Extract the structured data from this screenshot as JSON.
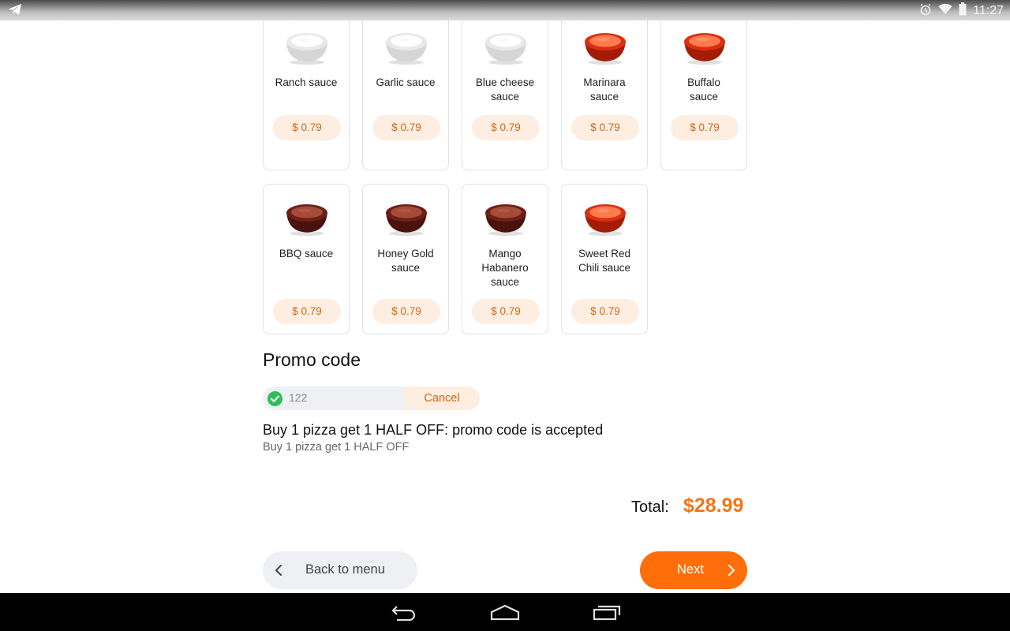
{
  "status_bar": {
    "time": "11:27",
    "icons": [
      "telegram-icon",
      "alarm-icon",
      "wifi-icon",
      "battery-icon"
    ]
  },
  "sauces": [
    {
      "name": "Ranch sauce",
      "price": "$ 0.79",
      "color": "white"
    },
    {
      "name": "Garlic sauce",
      "price": "$ 0.79",
      "color": "white"
    },
    {
      "name": "Blue cheese sauce",
      "price": "$ 0.79",
      "color": "white"
    },
    {
      "name": "Marinara sauce",
      "price": "$ 0.79",
      "color": "red"
    },
    {
      "name": "Buffalo sauce",
      "price": "$ 0.79",
      "color": "red"
    },
    {
      "name": "BBQ sauce",
      "price": "$ 0.79",
      "color": "brown"
    },
    {
      "name": "Honey Gold sauce",
      "price": "$ 0.79",
      "color": "brown"
    },
    {
      "name": "Mango Habanero sauce",
      "price": "$ 0.79",
      "color": "brown"
    },
    {
      "name": "Sweet Red Chili sauce",
      "price": "$ 0.79",
      "color": "red"
    }
  ],
  "promo": {
    "title": "Promo code",
    "value": "122",
    "cancel_label": "Cancel",
    "message": "Buy 1 pizza get 1 HALF OFF: promo code is accepted",
    "subtext": "Buy 1 pizza get 1 HALF OFF"
  },
  "total": {
    "label": "Total:",
    "value": "$28.99"
  },
  "footer": {
    "back_label": "Back to menu",
    "next_label": "Next"
  },
  "colors": {
    "accent": "#ff6e0b",
    "price_text": "#d3660f",
    "price_bg": "#fdeee1",
    "success": "#2ebd58"
  }
}
